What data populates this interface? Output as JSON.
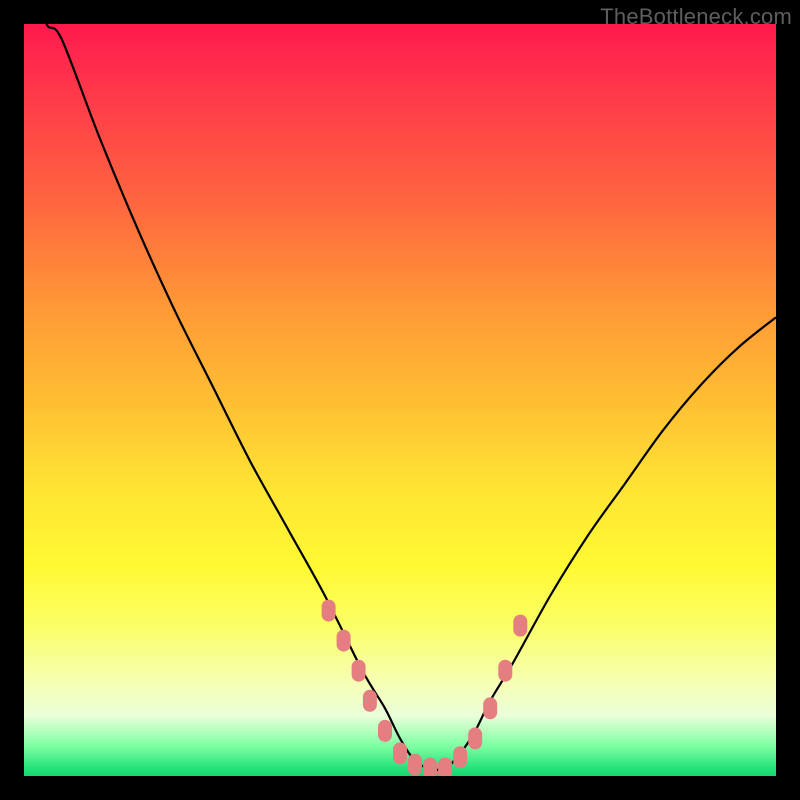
{
  "watermark": "TheBottleneck.com",
  "colors": {
    "frame": "#000000",
    "gradient_top": "#ff1a4d",
    "gradient_bottom": "#16d66e",
    "curve": "#000000",
    "markers": "#e57e80"
  },
  "chart_data": {
    "type": "line",
    "title": "",
    "xlabel": "",
    "ylabel": "",
    "xlim": [
      0,
      100
    ],
    "ylim": [
      0,
      100
    ],
    "grid": false,
    "legend": false,
    "note": "Axis ticks are not drawn; values estimated from pixel positions on a 0–100 normalized scale. y=0 is plot bottom; curve starts off-canvas at top-left, dips to a minimum near x≈52, rises toward the right edge.",
    "series": [
      {
        "name": "bottleneck-curve",
        "x": [
          3,
          5,
          10,
          15,
          20,
          25,
          30,
          35,
          40,
          45,
          48,
          50,
          52,
          54,
          56,
          58,
          60,
          62,
          65,
          70,
          75,
          80,
          85,
          90,
          95,
          100
        ],
        "y": [
          100,
          98,
          85,
          73,
          62,
          52,
          42,
          33,
          24,
          14,
          9,
          5,
          2,
          1,
          1,
          3,
          6,
          10,
          15,
          24,
          32,
          39,
          46,
          52,
          57,
          61
        ]
      }
    ],
    "markers": {
      "name": "highlighted-points",
      "shape": "rounded-rect",
      "x": [
        40.5,
        42.5,
        44.5,
        46,
        48,
        50,
        52,
        54,
        56,
        58,
        60,
        62,
        64,
        66
      ],
      "y": [
        22,
        18,
        14,
        10,
        6,
        3,
        1.5,
        1,
        1,
        2.5,
        5,
        9,
        14,
        20
      ]
    }
  }
}
